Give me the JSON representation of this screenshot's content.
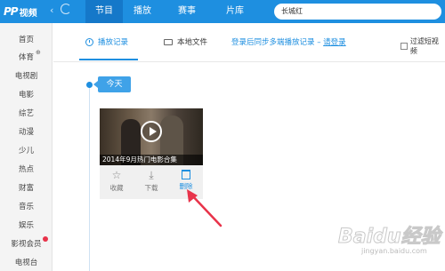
{
  "app": {
    "logo_text": "PP视频",
    "logo_mark": "PP",
    "logo_label": "视频"
  },
  "top_nav": {
    "tabs": [
      {
        "label": "节目",
        "active": true
      },
      {
        "label": "播放",
        "active": false
      },
      {
        "label": "赛事",
        "active": false
      },
      {
        "label": "片库",
        "active": false
      }
    ],
    "search_value": "长城红"
  },
  "sidebar": {
    "items": [
      {
        "label": "首页"
      },
      {
        "label": "体育"
      },
      {
        "label": "电视剧"
      },
      {
        "label": "电影"
      },
      {
        "label": "综艺"
      },
      {
        "label": "动漫"
      },
      {
        "label": "少儿"
      },
      {
        "label": "热点"
      },
      {
        "label": "财富"
      },
      {
        "label": "音乐"
      },
      {
        "label": "娱乐"
      },
      {
        "label": "影视会员"
      },
      {
        "label": "电视台"
      }
    ]
  },
  "sub_tabs": {
    "history_label": "播放记录",
    "local_label": "本地文件",
    "sync_text": "登录后同步多端播放记录 –",
    "login_link": "请登录",
    "filter_label": "过滤短视频"
  },
  "timeline": {
    "today_label": "今天"
  },
  "video_card": {
    "title": "2014年9月热门电影合集",
    "actions": {
      "favorite_label": "收藏",
      "download_label": "下载",
      "delete_label": "删除"
    }
  },
  "watermark": {
    "main": "Baidu经验",
    "sub": "jingyan.baidu.com"
  },
  "colors": {
    "accent": "#1e8fe0",
    "active_tab": "#1578c9",
    "arrow": "#e8334a"
  }
}
